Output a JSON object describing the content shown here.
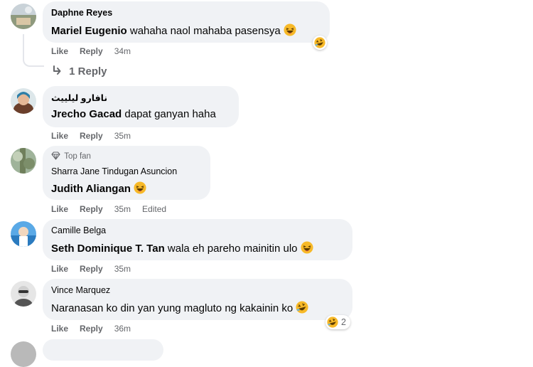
{
  "actions": {
    "like": "Like",
    "reply": "Reply",
    "edited": "Edited"
  },
  "comments": [
    {
      "author": "Daphne Reyes",
      "tag": "Mariel Eugenio",
      "text": " wahaha naol mahaba pasensya",
      "time": "34m",
      "replies_label": "1 Reply"
    },
    {
      "author": "نافارو ليلييث",
      "tag": "Jrecho Gacad",
      "text": " dapat ganyan haha",
      "time": "35m"
    },
    {
      "author": "Sharra Jane Tindugan Asuncion",
      "badge": "Top fan",
      "tag": "Judith Aliangan",
      "text": "",
      "time": "35m"
    },
    {
      "author": "Camille Belga",
      "tag": "Seth Dominique T. Tan",
      "text": " wala eh pareho mainitin ulo",
      "time": "35m"
    },
    {
      "author": "Vince Marquez",
      "tag": "",
      "text": "Naranasan ko din yan yung magluto ng kakainin ko",
      "time": "36m",
      "reaction_count": "2"
    }
  ]
}
